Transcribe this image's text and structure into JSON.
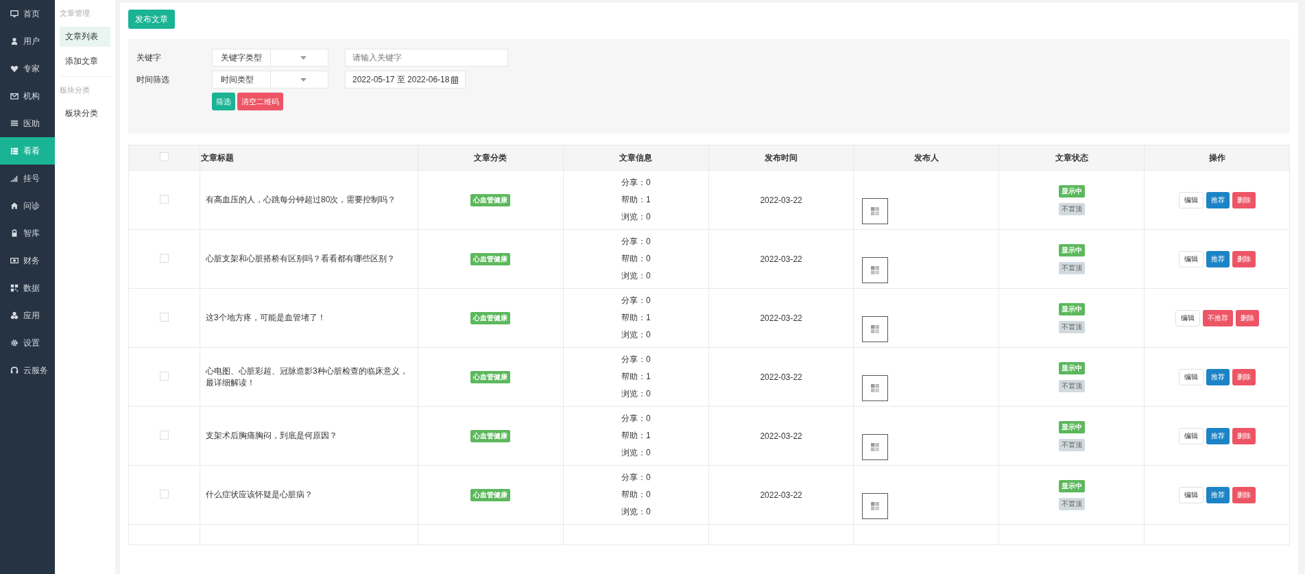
{
  "main_nav": {
    "items": [
      {
        "label": "首页",
        "selected": false
      },
      {
        "label": "用户",
        "selected": false
      },
      {
        "label": "专家",
        "selected": false
      },
      {
        "label": "机构",
        "selected": false
      },
      {
        "label": "医助",
        "selected": false
      },
      {
        "label": "看看",
        "selected": true
      },
      {
        "label": "挂号",
        "selected": false
      },
      {
        "label": "问诊",
        "selected": false
      },
      {
        "label": "智库",
        "selected": false
      },
      {
        "label": "财务",
        "selected": false
      },
      {
        "label": "数据",
        "selected": false
      },
      {
        "label": "应用",
        "selected": false
      },
      {
        "label": "设置",
        "selected": false
      },
      {
        "label": "云服务",
        "selected": false
      }
    ]
  },
  "sub_nav": {
    "groups": [
      {
        "title": "文章管理",
        "items": [
          {
            "label": "文章列表",
            "selected": true
          },
          {
            "label": "添加文章",
            "selected": false
          }
        ]
      },
      {
        "title": "板块分类",
        "items": [
          {
            "label": "板块分类",
            "selected": false
          }
        ]
      }
    ]
  },
  "publish_button": "发布文章",
  "filter": {
    "rows": [
      {
        "label": "关键字",
        "select": "关键字类型",
        "field": {
          "kind": "text",
          "placeholder": "请输入关键字"
        }
      },
      {
        "label": "时间筛选",
        "select": "时间类型",
        "field": {
          "kind": "date",
          "value": "2022-05-17 至 2022-06-18"
        }
      }
    ],
    "filter_button": "筛选",
    "clear_button": "清空二维码"
  },
  "table": {
    "select_all": {
      "checked": false
    },
    "columns": [
      "文章标题",
      "文章分类",
      "文章信息",
      "发布时间",
      "发布人",
      "文章状态",
      "操作"
    ],
    "rows": [
      {
        "checked": false,
        "title": "有高血压的人，心跳每分钟超过80次，需要控制吗？",
        "category": "心血管健康",
        "info": [
          "分享：0",
          "帮助：1",
          "浏览：0"
        ],
        "date": "2022-03-22",
        "status": [
          "显示中",
          "不置顶"
        ],
        "actions": [
          {
            "kind": "edit",
            "label": "编辑"
          },
          {
            "kind": "recommend",
            "label": "推荐"
          },
          {
            "kind": "delete",
            "label": "删除"
          }
        ]
      },
      {
        "checked": false,
        "title": "心脏支架和心脏搭桥有区别吗？看看都有哪些区别？",
        "category": "心血管健康",
        "info": [
          "分享：0",
          "帮助：0",
          "浏览：0"
        ],
        "date": "2022-03-22",
        "status": [
          "显示中",
          "不置顶"
        ],
        "actions": [
          {
            "kind": "edit",
            "label": "编辑"
          },
          {
            "kind": "recommend",
            "label": "推荐"
          },
          {
            "kind": "delete",
            "label": "删除"
          }
        ]
      },
      {
        "checked": false,
        "title": "这3个地方疼，可能是血管堵了！",
        "category": "心血管健康",
        "info": [
          "分享：0",
          "帮助：1",
          "浏览：0"
        ],
        "date": "2022-03-22",
        "status": [
          "显示中",
          "不置顶"
        ],
        "actions": [
          {
            "kind": "edit",
            "label": "编辑"
          },
          {
            "kind": "unrecommend",
            "label": "不推荐"
          },
          {
            "kind": "delete",
            "label": "删除"
          }
        ]
      },
      {
        "checked": false,
        "title": "心电图、心脏彩超、冠脉造影3种心脏检查的临床意义，最详细解读！",
        "category": "心血管健康",
        "info": [
          "分享：0",
          "帮助：1",
          "浏览：0"
        ],
        "date": "2022-03-22",
        "status": [
          "显示中",
          "不置顶"
        ],
        "actions": [
          {
            "kind": "edit",
            "label": "编辑"
          },
          {
            "kind": "recommend",
            "label": "推荐"
          },
          {
            "kind": "delete",
            "label": "删除"
          }
        ]
      },
      {
        "checked": false,
        "title": "支架术后胸痛胸闷，到底是何原因？",
        "category": "心血管健康",
        "info": [
          "分享：0",
          "帮助：1",
          "浏览：0"
        ],
        "date": "2022-03-22",
        "status": [
          "显示中",
          "不置顶"
        ],
        "actions": [
          {
            "kind": "edit",
            "label": "编辑"
          },
          {
            "kind": "recommend",
            "label": "推荐"
          },
          {
            "kind": "delete",
            "label": "删除"
          }
        ]
      },
      {
        "checked": false,
        "title": "什么症状应该怀疑是心脏病？",
        "category": "心血管健康",
        "info": [
          "分享：0",
          "帮助：0",
          "浏览：0"
        ],
        "date": "2022-03-22",
        "status": [
          "显示中",
          "不置顶"
        ],
        "actions": [
          {
            "kind": "edit",
            "label": "编辑"
          },
          {
            "kind": "recommend",
            "label": "推荐"
          },
          {
            "kind": "delete",
            "label": "删除"
          }
        ]
      }
    ]
  }
}
